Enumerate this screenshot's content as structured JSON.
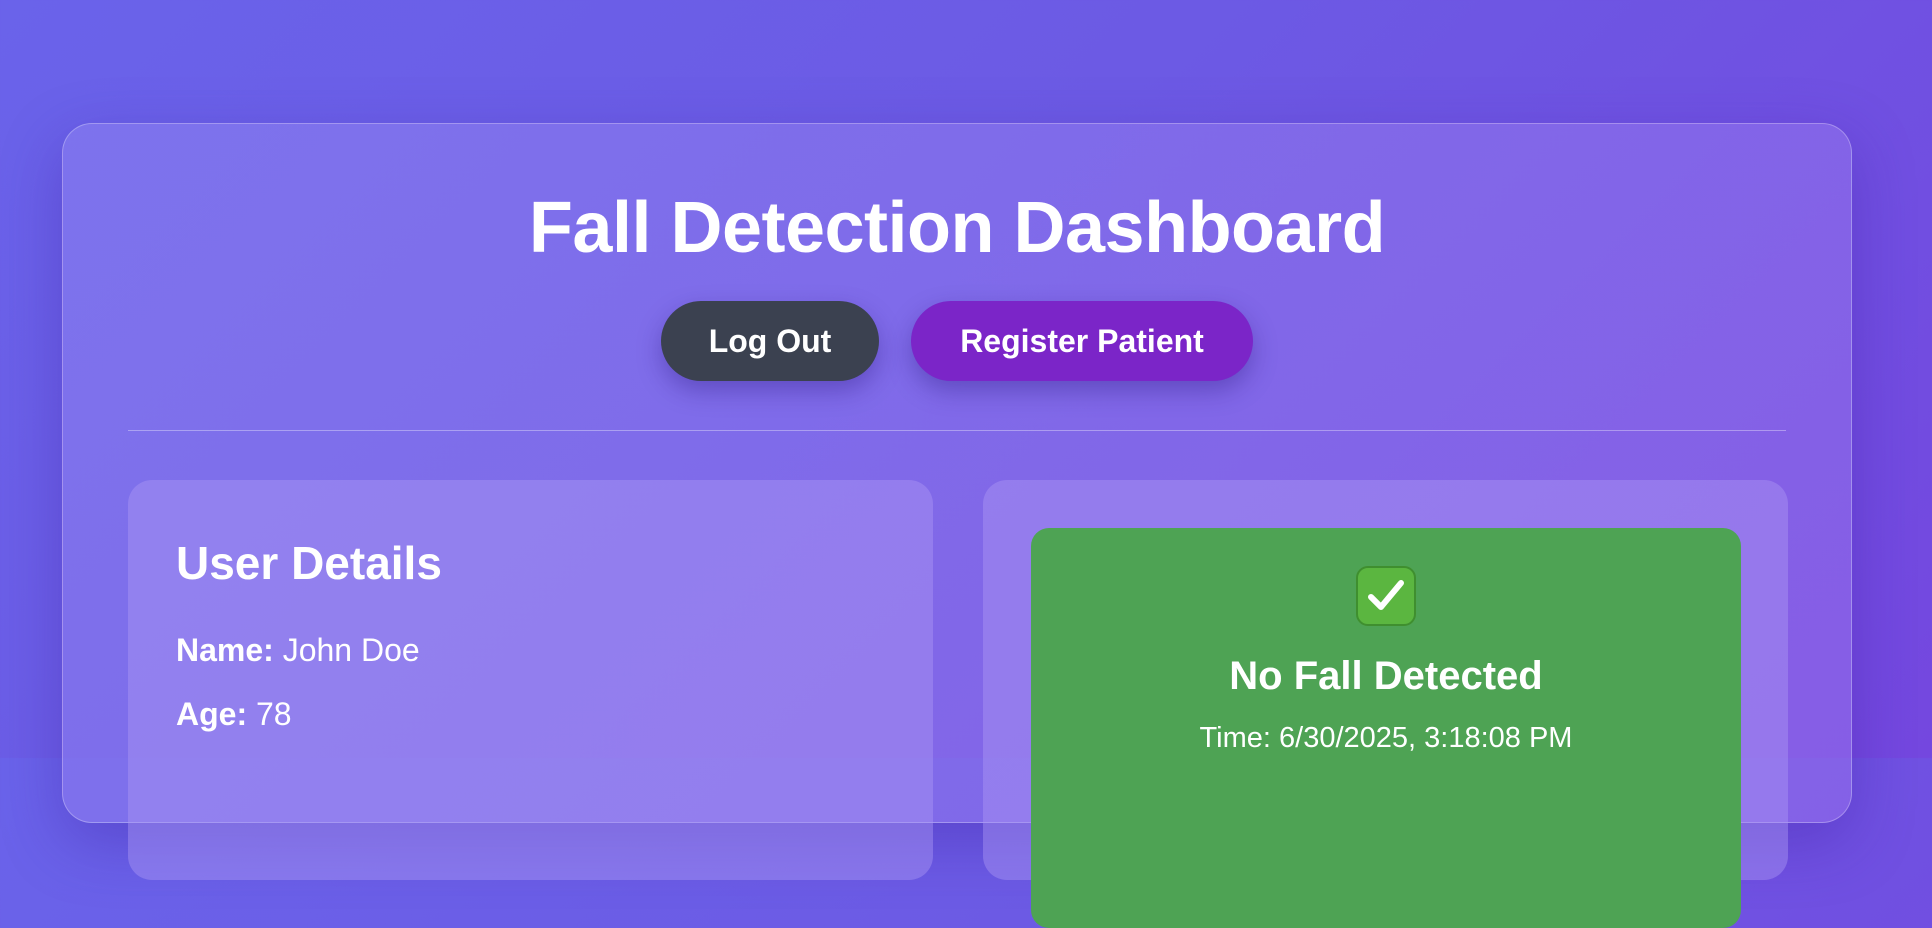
{
  "header": {
    "title": "Fall Detection Dashboard",
    "logout_label": "Log Out",
    "register_label": "Register Patient"
  },
  "user_details": {
    "title": "User Details",
    "name_label": "Name:",
    "name_value": "John Doe",
    "age_label": "Age:",
    "age_value": "78"
  },
  "status": {
    "icon": "check-mark-icon",
    "title": "No Fall Detected",
    "time": "Time: 6/30/2025, 3:18:08 PM",
    "color": "#4ea354"
  },
  "colors": {
    "background_start": "#6a63ea",
    "background_end": "#7447df",
    "logout_button": "#3b4150",
    "register_button": "#7b25c8"
  }
}
